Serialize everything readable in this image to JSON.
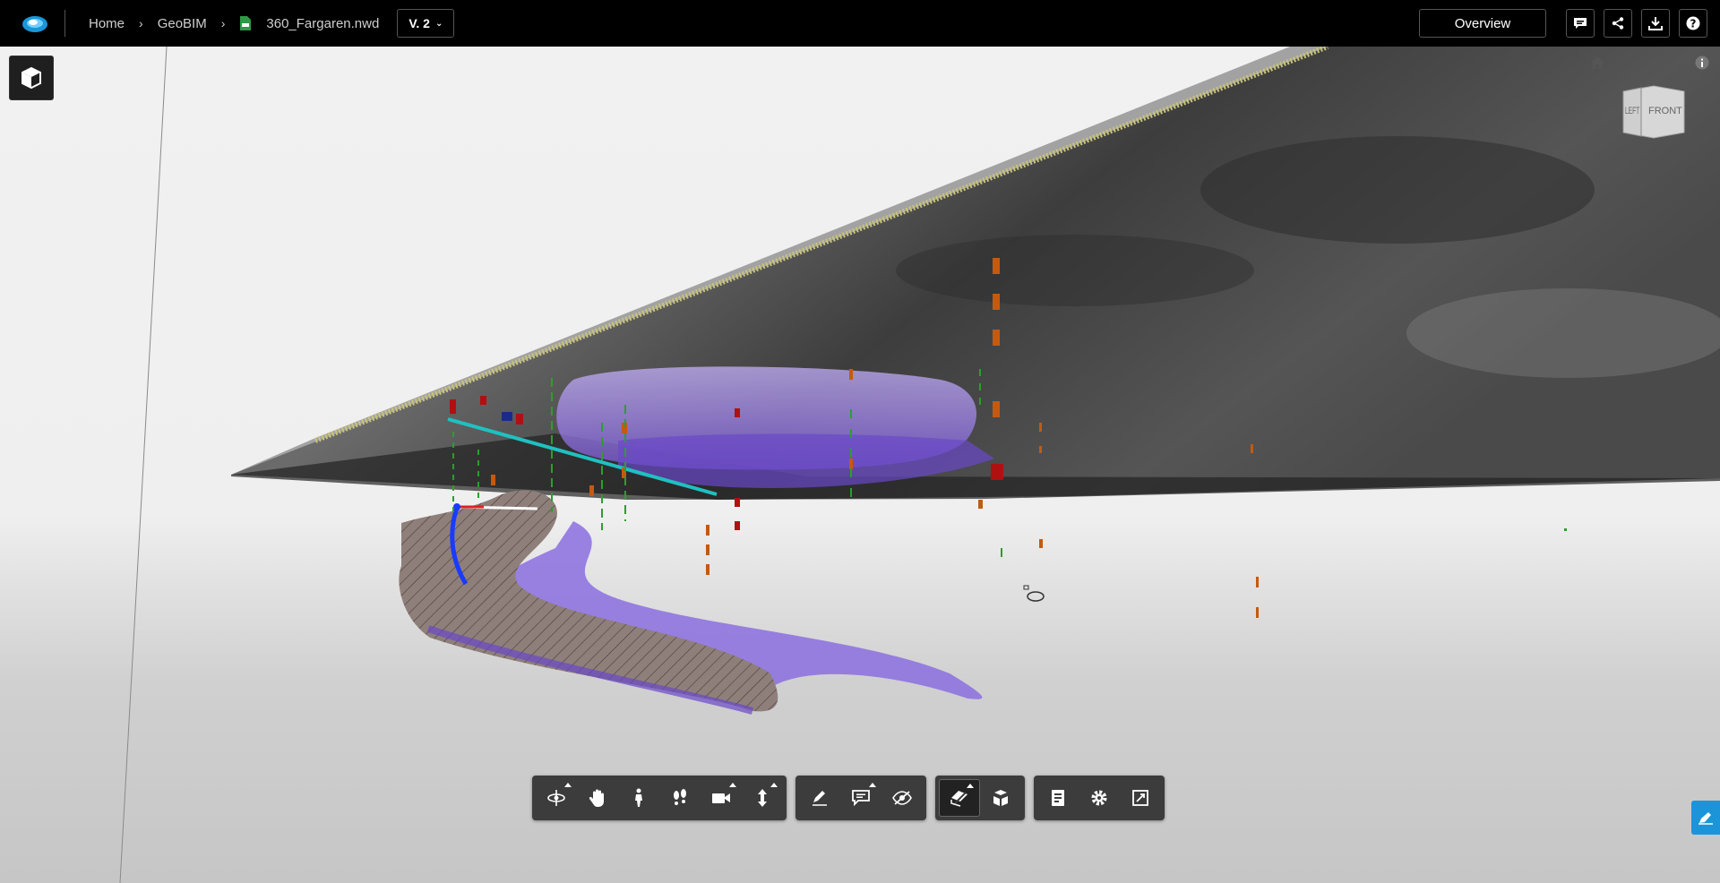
{
  "topbar": {
    "breadcrumb": [
      "Home",
      "GeoBIM",
      "360_Fargaren.nwd"
    ],
    "separator": "›",
    "version_label": "V. 2",
    "overview_label": "Overview",
    "icons": [
      "app-logo-icon",
      "nwd-file-icon",
      "comment-icon",
      "share-icon",
      "download-icon",
      "help-icon"
    ]
  },
  "viewcube": {
    "left_label": "LEFT",
    "front_label": "FRONT"
  },
  "toolbar": {
    "groups": [
      [
        "orbit-icon",
        "pan-icon",
        "walk-icon",
        "footprints-icon",
        "camera-icon",
        "vertical-move-icon"
      ],
      [
        "markup-icon",
        "comment-icon",
        "hide-icon"
      ],
      [
        "section-icon",
        "explode-icon"
      ],
      [
        "properties-icon",
        "settings-icon",
        "fullscreen-icon"
      ]
    ]
  },
  "colors": {
    "accent": "#1b95d8",
    "toolbar_bg": "#3c3c3c",
    "topbar_bg": "#000000",
    "model_purple": "#9a7ee0",
    "terrain_dark": "#3e3e3e"
  }
}
